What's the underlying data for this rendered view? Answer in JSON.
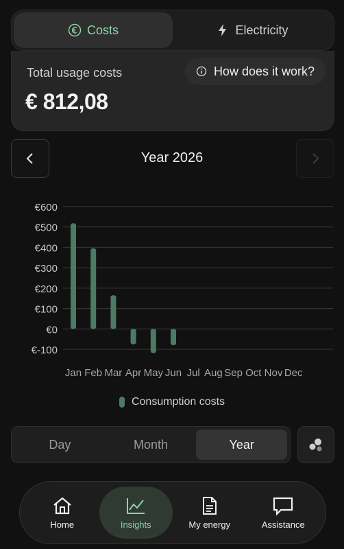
{
  "top_tabs": [
    {
      "label": "Costs",
      "icon": "euro-icon",
      "active": true
    },
    {
      "label": "Electricity",
      "icon": "lightning-icon",
      "active": false
    }
  ],
  "summary": {
    "label": "Total usage costs",
    "value": "€ 812,08",
    "how_label": "How does it work?"
  },
  "period_title": "Year 2026",
  "chart_data": {
    "type": "bar",
    "categories": [
      "Jan",
      "Feb",
      "Mar",
      "Apr",
      "May",
      "Jun",
      "Jul",
      "Aug",
      "Sep",
      "Oct",
      "Nov",
      "Dec"
    ],
    "series": [
      {
        "name": "Consumption costs",
        "values": [
          518,
          395,
          165,
          -75,
          -118,
          -80,
          null,
          null,
          null,
          null,
          null,
          null
        ]
      }
    ],
    "ytick_labels": [
      "€600",
      "€500",
      "€400",
      "€300",
      "€200",
      "€100",
      "€0",
      "€-100"
    ],
    "yticks": [
      600,
      500,
      400,
      300,
      200,
      100,
      0,
      -100
    ],
    "ylim": [
      -100,
      600
    ],
    "bar_color": "#4d7a62",
    "grid": true,
    "legend_position": "bottom-center"
  },
  "period_tabs": [
    {
      "label": "Day",
      "active": false
    },
    {
      "label": "Month",
      "active": false
    },
    {
      "label": "Year",
      "active": true
    }
  ],
  "bottom_nav": [
    {
      "label": "Home",
      "icon": "home-icon",
      "active": false
    },
    {
      "label": "Insights",
      "icon": "chart-line-icon",
      "active": true
    },
    {
      "label": "My energy",
      "icon": "document-icon",
      "active": false
    },
    {
      "label": "Assistance",
      "icon": "chat-icon",
      "active": false
    }
  ],
  "colors": {
    "accent": "#8fd1a6",
    "bar": "#4d7a62",
    "background": "#111111"
  }
}
